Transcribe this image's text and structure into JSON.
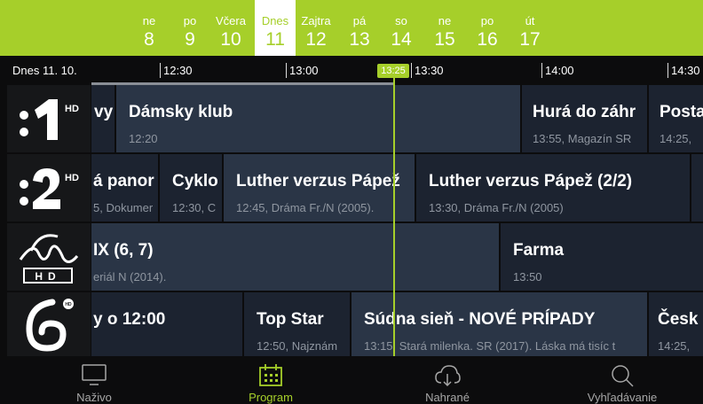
{
  "days": [
    {
      "dw": "ne",
      "dn": "8"
    },
    {
      "dw": "po",
      "dn": "9"
    },
    {
      "dw": "Včera",
      "dn": "10"
    },
    {
      "dw": "Dnes",
      "dn": "11",
      "selected": true
    },
    {
      "dw": "Zajtra",
      "dn": "12"
    },
    {
      "dw": "pá",
      "dn": "13"
    },
    {
      "dw": "so",
      "dn": "14"
    },
    {
      "dw": "ne",
      "dn": "15"
    },
    {
      "dw": "po",
      "dn": "16"
    },
    {
      "dw": "út",
      "dn": "17"
    }
  ],
  "timeline": {
    "date": "Dnes 11. 10.",
    "ticks": [
      "12:30",
      "13:00",
      "13:30",
      "14:00",
      "14:30"
    ],
    "now": "13:25"
  },
  "channels": [
    {
      "logo": ":1",
      "hd": "HD",
      "programs": [
        {
          "title": "vy P",
          "sub": ""
        },
        {
          "title": "Dámsky klub",
          "sub": "12:20",
          "live": true
        },
        {
          "title": "Hurá do záhr",
          "sub": "13:55, Magazín SR"
        },
        {
          "title": "Posta",
          "sub": "14:25,"
        }
      ]
    },
    {
      "logo": ":2",
      "hd": "HD",
      "programs": [
        {
          "title": "á panor",
          "sub": "5, Dokumer"
        },
        {
          "title": "Cyklo",
          "sub": "12:30, C"
        },
        {
          "title": "Luther verzus Pápež",
          "sub": "12:45, Dráma Fr./N (2005).",
          "live": true
        },
        {
          "title": "Luther verzus Pápež (2/2)",
          "sub": "13:30, Dráma Fr./N (2005)"
        }
      ]
    },
    {
      "logo": "JOJ",
      "hd": "HD",
      "programs": [
        {
          "title": "IX (6, 7)",
          "sub": "eriál N (2014).",
          "live": true
        },
        {
          "title": "Farma",
          "sub": "13:50"
        }
      ]
    },
    {
      "logo": "Markíza",
      "hd": "HD",
      "programs": [
        {
          "title": "y o 12:00",
          "sub": ""
        },
        {
          "title": "Top Star",
          "sub": "12:50, Najznám"
        },
        {
          "title": "Súdna sieň - NOVÉ PRÍPADY",
          "sub": "13:15, Stará milenka. SR (2017). Láska má tisíc t",
          "live": true
        },
        {
          "title": "Česk",
          "sub": "14:25,"
        }
      ]
    }
  ],
  "tabs": [
    {
      "label": "Naživo",
      "icon": "tv-icon"
    },
    {
      "label": "Program",
      "icon": "calendar-icon",
      "active": true
    },
    {
      "label": "Nahrané",
      "icon": "cloud-download-icon"
    },
    {
      "label": "Vyhľadávanie",
      "icon": "search-icon"
    }
  ],
  "colors": {
    "accent": "#a6cf2a",
    "live_bg": "#2a3546",
    "prog_bg": "#1c2330"
  }
}
